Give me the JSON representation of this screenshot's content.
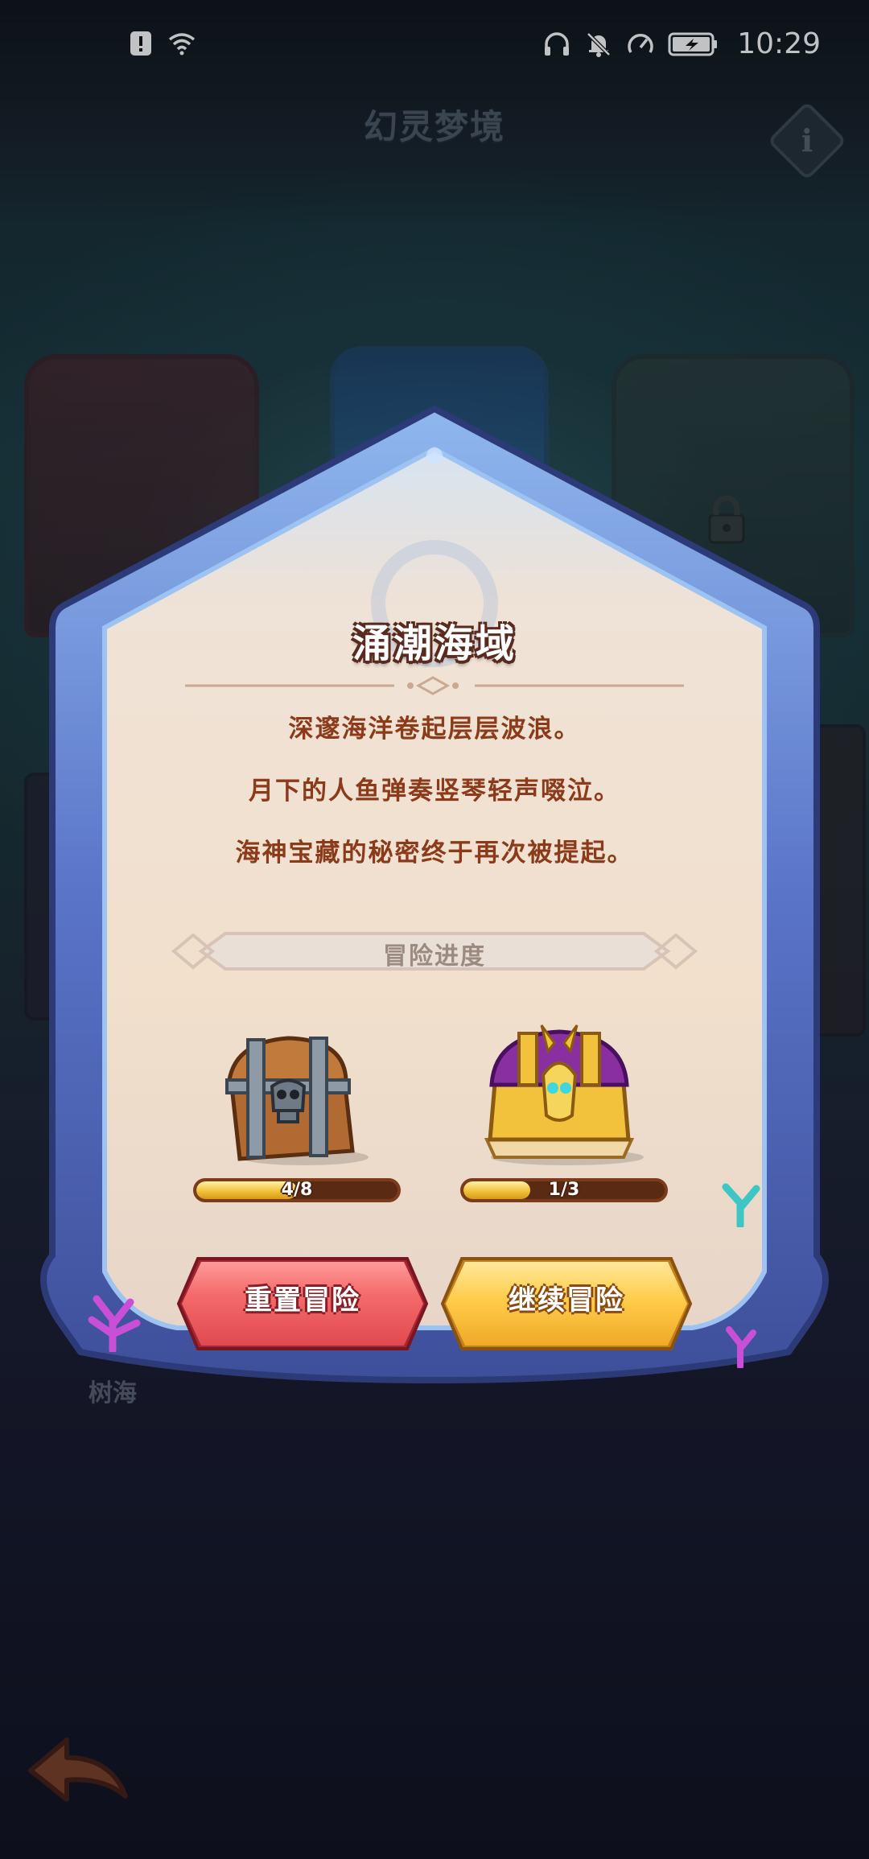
{
  "status_bar": {
    "time": "10:29",
    "left_icons": [
      "alert-sim-icon",
      "wifi-icon"
    ],
    "right_icons": [
      "headphones-icon",
      "mute-bell-icon",
      "speed-icon",
      "battery-charging-icon"
    ]
  },
  "header": {
    "title": "幻灵梦境",
    "info_label": "i"
  },
  "background": {
    "stage_label": "树海"
  },
  "modal": {
    "title": "涌潮海域",
    "story_lines": [
      "深邃海洋卷起层层波浪。",
      "月下的人鱼弹奏竖琴轻声啜泣。",
      "海神宝藏的秘密终于再次被提起。"
    ],
    "progress_label": "冒险进度",
    "rewards": [
      {
        "name": "iron-skull-chest",
        "current": 4,
        "total": 8,
        "text": "4/8"
      },
      {
        "name": "golden-purple-chest",
        "current": 1,
        "total": 3,
        "text": "1/3"
      }
    ],
    "buttons": {
      "reset": "重置冒险",
      "continue": "继续冒险"
    }
  },
  "colors": {
    "story_text": "#8b3a1a",
    "reset_button": "#f46a6a",
    "continue_button": "#ffcc4a",
    "frame": "#5a74c8"
  }
}
